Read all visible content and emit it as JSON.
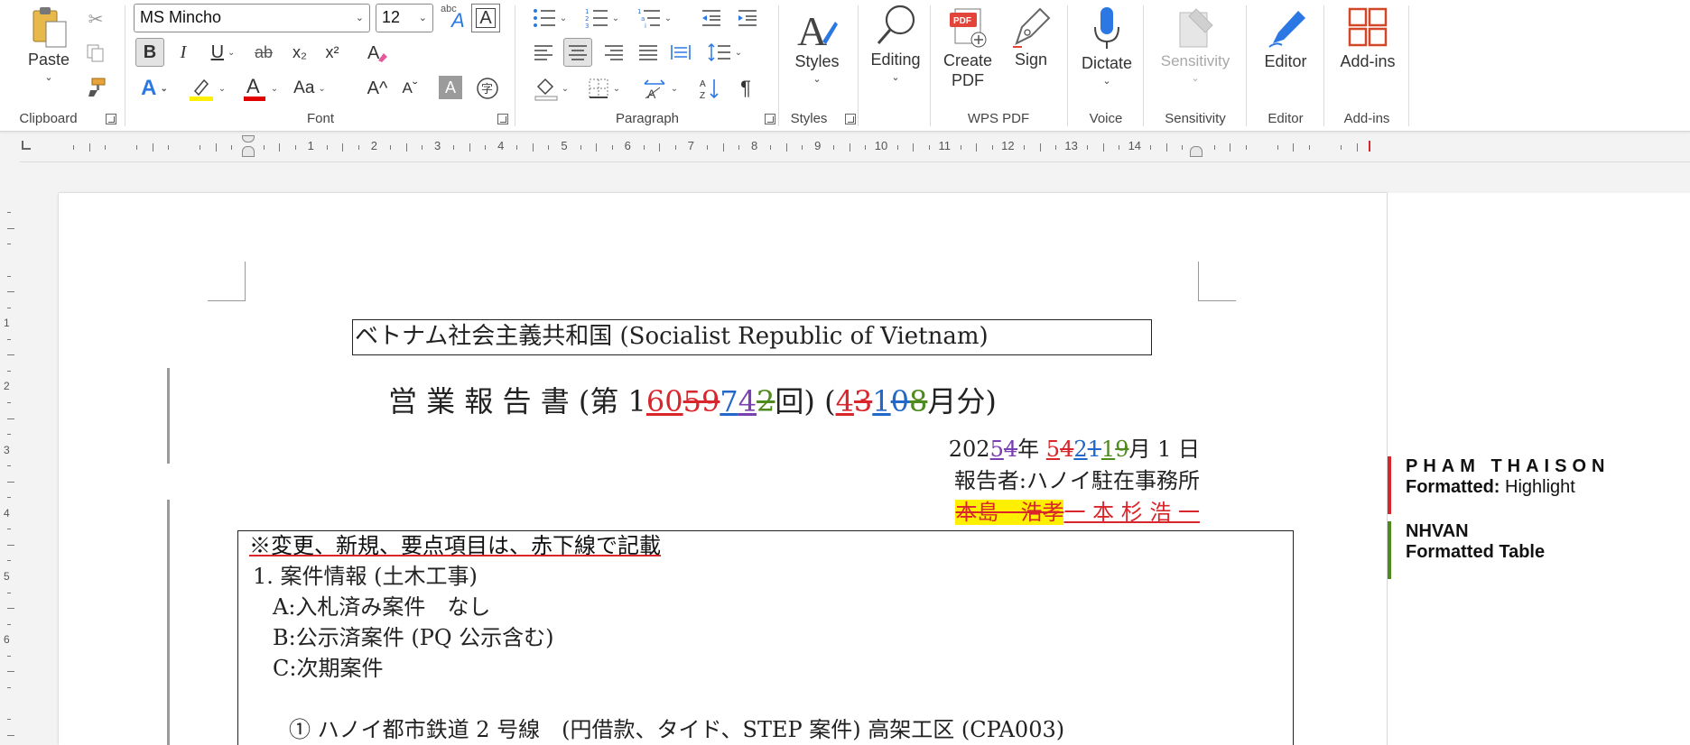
{
  "ribbon": {
    "clipboard": {
      "label": "Clipboard",
      "paste": "Paste"
    },
    "font": {
      "label": "Font",
      "family": "MS Mincho",
      "size": "12",
      "bold": "B",
      "italic": "I",
      "underline": "U",
      "strike": "ab",
      "subscript": "x₂",
      "superscript": "x²",
      "change_case": "Aa",
      "grow": "A^",
      "shrink": "Aˇ",
      "shade": "A",
      "abc": "abc"
    },
    "paragraph": {
      "label": "Paragraph",
      "pilcrow": "¶"
    },
    "styles": {
      "label": "Styles",
      "button": "Styles"
    },
    "editing": {
      "button": "Editing"
    },
    "wps_pdf": {
      "label": "WPS PDF",
      "create": "Create PDF",
      "create_line1": "Create",
      "create_line2": "PDF",
      "sign": "Sign",
      "pdf_badge": "PDF"
    },
    "voice": {
      "label": "Voice",
      "button": "Dictate"
    },
    "sensitivity": {
      "label": "Sensitivity",
      "button": "Sensitivity"
    },
    "editor": {
      "label": "Editor",
      "button": "Editor"
    },
    "addins": {
      "label": "Add-ins",
      "button": "Add-ins"
    }
  },
  "ruler": {
    "h_labels": [
      "1",
      "2",
      "3",
      "4",
      "5",
      "6",
      "7",
      "8",
      "9",
      "10",
      "11",
      "12",
      "13",
      "14"
    ],
    "v_labels": [
      "1",
      "2",
      "3",
      "4",
      "5",
      "6"
    ]
  },
  "document": {
    "country_box": "ベトナム社会主義共和国 (Socialist Republic of Vietnam)",
    "title": {
      "prefix": "営 業 報 告 書 (第 1",
      "ins1": "60",
      "del1": "59",
      "ins2": "7",
      "ins3": "4",
      "del2": "2",
      "mid": "回) (",
      "m_ins1": "4",
      "m_del1": "3",
      "m_ins2": "1",
      "m_del2": "0",
      "m_del3": "8",
      "suffix": "月分)"
    },
    "date": {
      "year_prefix": "202",
      "year_ins": "5",
      "year_del": "4",
      "year_suffix": "年 ",
      "m1": "5",
      "m2": "4",
      "m3": "2",
      "m4": "1",
      "m5": "1",
      "m6": "9",
      "day": "月 1 日"
    },
    "reporter": "報告者:ハノイ駐在事務所",
    "name_deleted": "本島　浩孝",
    "name_inserted": "一 本 杉 浩 一",
    "box": {
      "note": "※変更、新規、要点項目は、赤下線で記載",
      "section1": "1. 案件情報 (土木工事)",
      "a": "A:入札済み案件　なし",
      "b": "B:公示済案件 (PQ 公示含む)",
      "c": "C:次期案件",
      "item1": "① ハノイ都市鉄道 2 号線　(円借款、タイド、STEP 案件) 高架工区 (CPA003)"
    }
  },
  "comments": [
    {
      "author": "PHAM THAISON",
      "label": "Formatted:",
      "value": "Highlight",
      "color": "#d9262c"
    },
    {
      "author": "NHVAN",
      "label": "Formatted Table",
      "value": "",
      "color": "#4f8a1e"
    }
  ]
}
